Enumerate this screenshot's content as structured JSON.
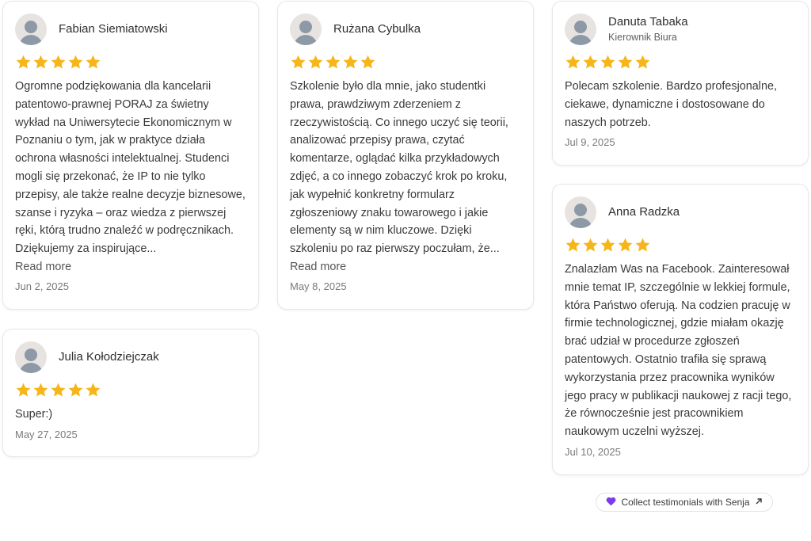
{
  "rating_stars": 5,
  "colors": {
    "star": "#f6b619",
    "heart": "#7c3aed"
  },
  "reviews": [
    {
      "name": "Fabian Siemiatowski",
      "text": "Ogromne podziękowania dla kancelarii patentowo-prawnej PORAJ za świetny wykład na Uniwersytecie Ekonomicznym w Poznaniu o tym, jak w praktyce działa ochrona własności intelektualnej. Studenci mogli się przekonać, że IP to nie tylko przepisy, ale także realne decyzje biznesowe, szanse i ryzyka – oraz wiedza z pierwszej ręki, którą trudno znaleźć w podręcznikach. Dziękujemy za inspirujące...",
      "read_more": "Read more",
      "date": "Jun 2, 2025"
    },
    {
      "name": "Julia Kołodziejczak",
      "text": "Super:)",
      "date": "May 27, 2025"
    },
    {
      "name": "Rużana Cybulka",
      "text": "Szkolenie było dla mnie, jako studentki prawa, prawdziwym zderzeniem z rzeczywistością. Co innego uczyć się teorii, analizować przepisy prawa, czytać komentarze, oglądać kilka przykładowych zdjęć, a co innego zobaczyć krok po kroku, jak wypełnić konkretny formularz zgłoszeniowy znaku towarowego i jakie elementy są w nim kluczowe. Dzięki szkoleniu po raz pierwszy poczułam, że...",
      "read_more": "Read more",
      "date": "May 8, 2025"
    },
    {
      "name": "Danuta Tabaka",
      "role": "Kierownik Biura",
      "text": "Polecam szkolenie. Bardzo profesjonalne, ciekawe, dynamiczne i dostosowane do naszych potrzeb.",
      "date": "Jul 9, 2025"
    },
    {
      "name": "Anna Radzka",
      "text": "Znalazłam Was na Facebook. Zainteresował mnie temat IP, szczególnie w lekkiej formule, która Państwo oferują. Na codzien pracuję w firmie technologicznej, gdzie miałam okazję brać udział w procedurze zgłoszeń patentowych. Ostatnio trafiła się sprawą wykorzystania przez pracownika wyników jego pracy w publikacji naukowej z racji tego, że równocześnie jest pracownikiem naukowym uczelni wyższej.",
      "date": "Jul 10, 2025"
    }
  ],
  "badge": {
    "label": "Collect testimonials with Senja",
    "icons": [
      "heart-icon",
      "arrow-up-right-icon"
    ]
  }
}
